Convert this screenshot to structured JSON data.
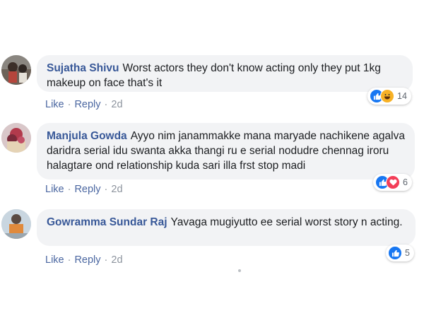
{
  "comments": [
    {
      "author": "Sujatha Shivu",
      "text": "Worst actors they don't know acting only they put 1kg makeup on face that's it",
      "actions": {
        "like": "Like",
        "reply": "Reply",
        "time": "2d"
      },
      "reaction_count": "14",
      "reactions": [
        "like-icon",
        "haha-icon"
      ]
    },
    {
      "author": "Manjula Gowda",
      "text": "Ayyo nim janammakke mana maryade nachikene agalva daridra serial idu swanta akka thangi ru e serial nodudre chennag iroru halagtare ond relationship kuda sari illa frst stop madi",
      "actions": {
        "like": "Like",
        "reply": "Reply",
        "time": "2d"
      },
      "reaction_count": "6",
      "reactions": [
        "like-icon",
        "love-icon"
      ]
    },
    {
      "author": "Gowramma Sundar Raj",
      "text": "Yavaga mugiyutto ee serial worst story n acting.",
      "actions": {
        "like": "Like",
        "reply": "Reply",
        "time": "2d"
      },
      "reaction_count": "5",
      "reactions": [
        "like-icon"
      ]
    }
  ],
  "colors": {
    "author": "#385898",
    "bubble": "#f2f3f5",
    "like": "#1877f2",
    "love": "#f33e58",
    "haha": "#f7b125"
  }
}
